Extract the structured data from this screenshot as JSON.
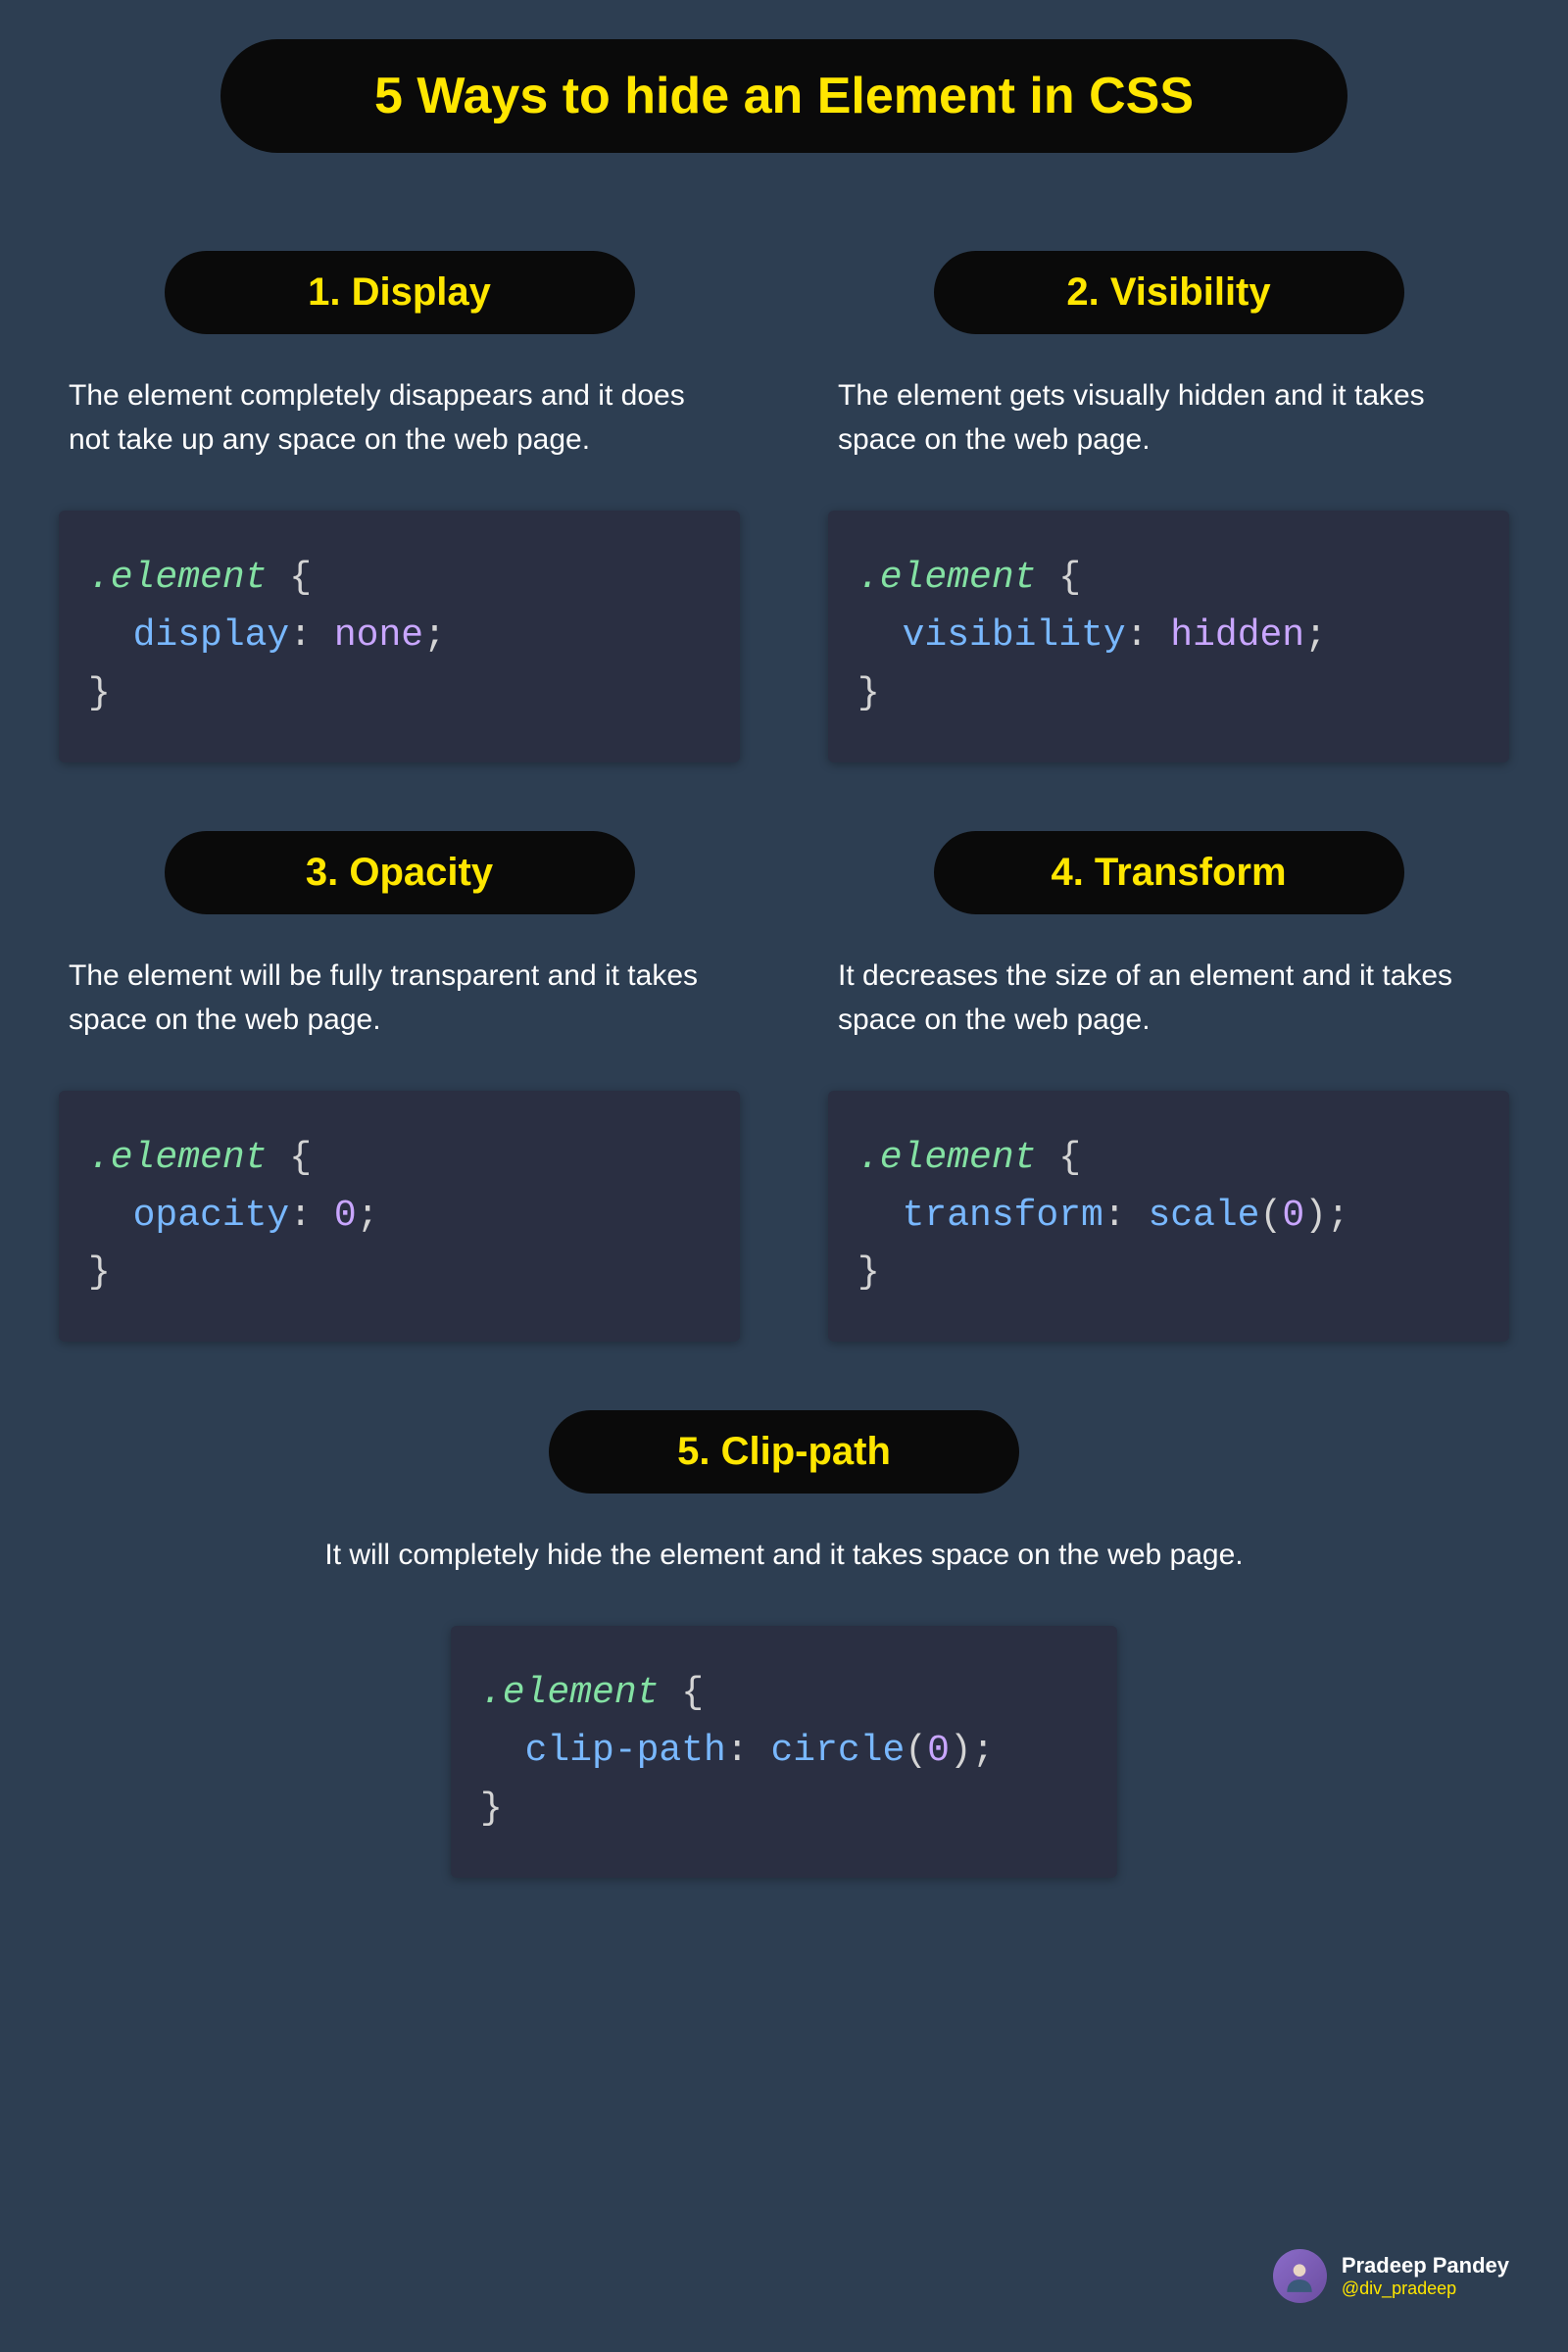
{
  "title": "5 Ways to hide an Element in CSS",
  "sections": [
    {
      "heading": "1. Display",
      "description": "The element completely disappears and it does not take up any space on the web page.",
      "code": {
        "selector": ".element",
        "property": "display",
        "value": "none"
      }
    },
    {
      "heading": "2. Visibility",
      "description": "The element gets visually hidden and it takes space on the web page.",
      "code": {
        "selector": ".element",
        "property": "visibility",
        "value": "hidden"
      }
    },
    {
      "heading": "3. Opacity",
      "description": "The element will be fully transparent and it takes space on the web page.",
      "code": {
        "selector": ".element",
        "property": "opacity",
        "value": "0"
      }
    },
    {
      "heading": "4. Transform",
      "description": "It decreases the size of an element and it takes space on the web page.",
      "code": {
        "selector": ".element",
        "property": "transform",
        "func": "scale",
        "arg": "0"
      }
    },
    {
      "heading": "5.  Clip-path",
      "description": "It will completely hide the element and it takes space on the web page.",
      "code": {
        "selector": ".element",
        "property": "clip-path",
        "func": "circle",
        "arg": "0"
      }
    }
  ],
  "author": {
    "name": "Pradeep Pandey",
    "handle": "@div_pradeep"
  }
}
